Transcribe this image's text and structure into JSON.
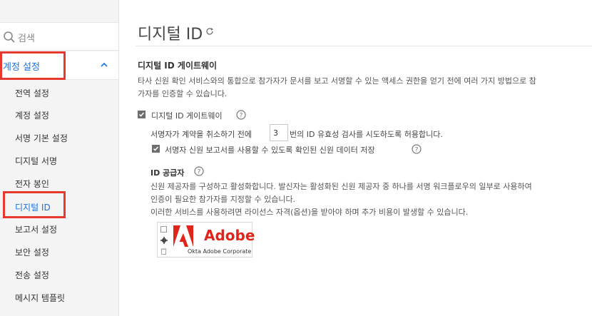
{
  "sidebar": {
    "search_placeholder": "검색",
    "group_label": "계정 설정",
    "items": [
      {
        "label": "전역 설정"
      },
      {
        "label": "계정 설정"
      },
      {
        "label": "서명 기본 설정"
      },
      {
        "label": "디지털 서명"
      },
      {
        "label": "전자 봉인"
      },
      {
        "label": "디지털 ID",
        "active": true
      },
      {
        "label": "보고서 설정"
      },
      {
        "label": "보안 설정"
      },
      {
        "label": "전송 설정"
      },
      {
        "label": "메시지 템플릿"
      }
    ]
  },
  "main": {
    "title": "디지털 ID",
    "section_title": "디지털 ID 게이트웨이",
    "description_line1": "타사 신원 확인 서비스와의 통합으로 참가자가 문서를 보고 서명할 수 있는 액세스 권한을 얻기 전에 여러 가지 방법으로 참",
    "description_line2": "가자를 인증할 수 있습니다.",
    "gateway_checkbox_label": "디지털 ID 게이트웨이",
    "retry_before": "서명자가 계약을 취소하기 전에",
    "retry_value": "3",
    "retry_after": "번의 ID 유효성 검사를 시도하도록 허용합니다.",
    "report_checkbox_label": "서명자 신원 보고서를 사용할 수 있도록 확인된 신원 데이터 저장",
    "idp_title": "ID 공급자",
    "idp_desc_line1": "신원 제공자를 구성하고 활성화합니다. 발신자는 활성화된 신원 제공자 중 하나를 서명 워크플로우의 일부로 사용하여",
    "idp_desc_line2": "인증이 필요한 참가자를 지정할 수 있습니다.",
    "idp_desc_line3": "이러한 서비스를 사용하려면 라이선스 자격(옵션)을 받아야 하며 추가 비용이 발생할 수 있습니다.",
    "provider": {
      "brand": "Adobe",
      "subtitle": "Okta Adobe Corporate"
    }
  },
  "colors": {
    "accent": "#1473e6",
    "highlight": "#e8392f",
    "adobe_red": "#e1251b"
  }
}
